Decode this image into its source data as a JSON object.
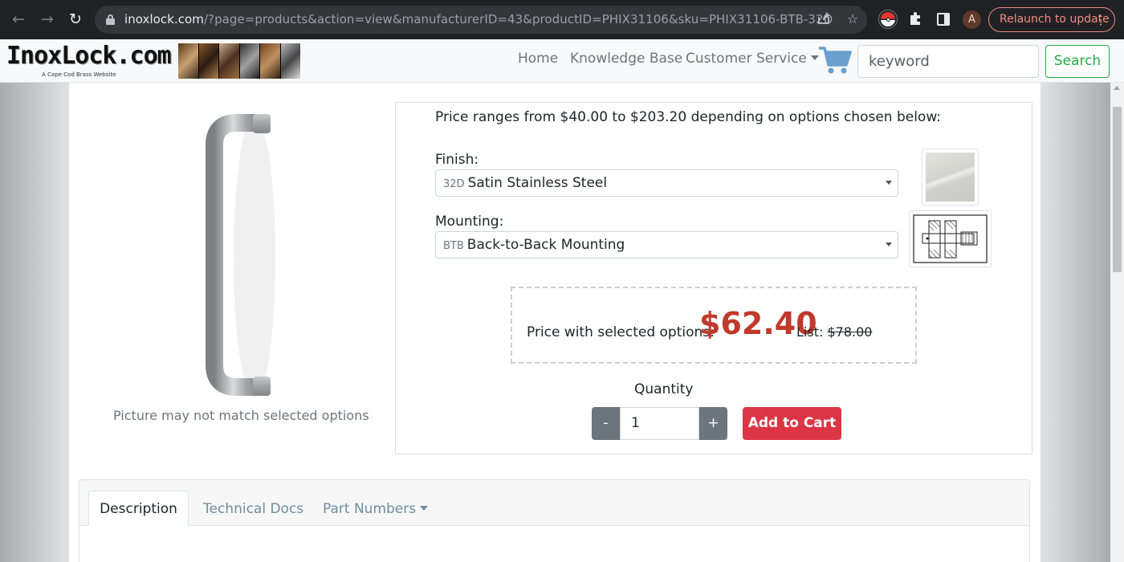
{
  "browser": {
    "url_domain": "inoxlock.com",
    "url_path": "/?page=products&action=view&manufacturerID=43&productID=PHIX31106&sku=PHIX31106-BTB-32D",
    "avatar_initial": "A",
    "relaunch_label": "Relaunch to update",
    "icons": [
      "back-arrow-icon",
      "forward-arrow-icon",
      "reload-icon",
      "lock-icon",
      "share-icon",
      "star-icon",
      "pokeball-extension-icon",
      "puzzle-icon",
      "side-panel-icon",
      "kebab-menu-icon"
    ]
  },
  "site": {
    "logo_text": "InoxLock.com",
    "logo_subtext": "A Cape Cod Brass Website",
    "nav": {
      "home": "Home",
      "knowledge_base": "Knowledge Base",
      "customer_service": "Customer Service"
    },
    "search": {
      "placeholder": "keyword",
      "button": "Search"
    }
  },
  "product": {
    "image_caption": "Picture may not match selected options",
    "price_range": "Price ranges from $40.00 to $203.20 depending on options chosen below:",
    "finish": {
      "label": "Finish:",
      "code": "32D",
      "value": "Satin Stainless Steel"
    },
    "mounting": {
      "label": "Mounting:",
      "code": "BTB",
      "value": "Back-to-Back Mounting"
    },
    "price_label": "Price with selected options:",
    "price": "$62.40",
    "list_label": "List:",
    "list_price": "$78.00",
    "quantity_label": "Quantity",
    "quantity": "1",
    "minus": "-",
    "plus": "+",
    "add_to_cart": "Add to Cart"
  },
  "tabs": {
    "description": "Description",
    "technical_docs": "Technical Docs",
    "part_numbers": "Part Numbers"
  },
  "colors": {
    "price_red": "#c0392b",
    "add_to_cart_red": "#dc3545",
    "search_green": "#28a745",
    "chrome_dark": "#202124"
  }
}
